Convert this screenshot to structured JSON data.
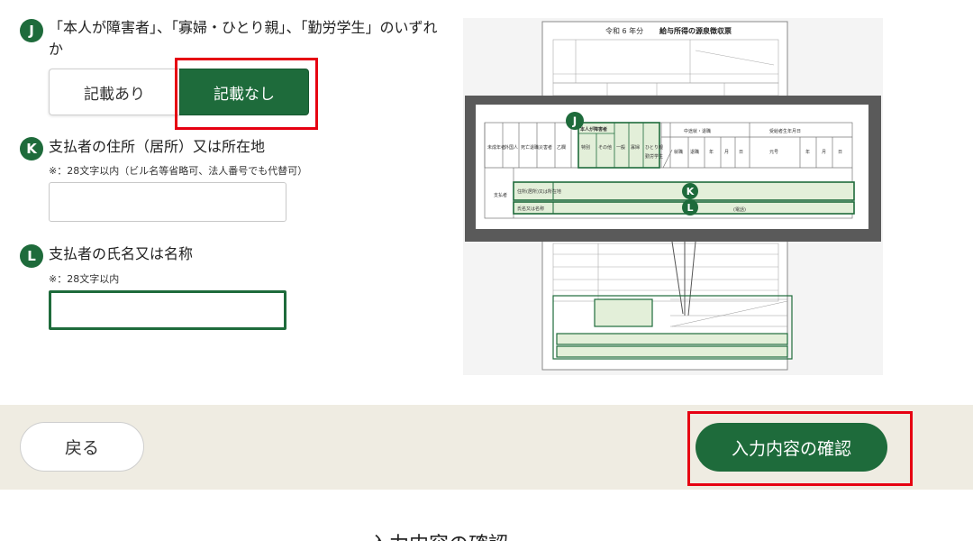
{
  "question_j": {
    "badge": "J",
    "text": "「本人が障害者」、「寡婦・ひとり親」、「勤労学生」のいずれか",
    "options": [
      "記載あり",
      "記載なし"
    ],
    "selected": "記載なし"
  },
  "question_k": {
    "badge": "K",
    "label": "支払者の住所（居所）又は所在地",
    "note": "※：28文字以内（ビル名等省略可、法人番号でも代替可）",
    "value": ""
  },
  "question_l": {
    "badge": "L",
    "label": "支払者の氏名又は名称",
    "note": "※：28文字以内",
    "value": ""
  },
  "figure": {
    "doc_year": "令和 6 年分",
    "doc_title": "給与所得の源泉徴収票",
    "zoom_badges": [
      "J",
      "K",
      "L"
    ],
    "zoom_header_main": "本人が障害者",
    "zoom_header_right": "中途就・退職",
    "zoom_header_birth": "受給者生年月日",
    "zoom_cols_left": [
      "未成年者",
      "外国人",
      "死亡退職",
      "災害者",
      "乙欄"
    ],
    "zoom_cols_j": [
      "特別",
      "その他",
      "一般",
      "寡婦",
      "ひとり親",
      "勤労学生"
    ],
    "zoom_cols_right": [
      "就職",
      "退職",
      "年",
      "月",
      "日",
      "元号",
      "年",
      "月",
      "日"
    ],
    "zoom_payer_side": "支払者",
    "zoom_row_k": "住所(居所)又は所在地",
    "zoom_row_l": "氏名又は名称",
    "zoom_phone": "(電話)"
  },
  "footer": {
    "back": "戻る",
    "confirm": "入力内容の確認"
  },
  "below_text": "入力内容の確認"
}
